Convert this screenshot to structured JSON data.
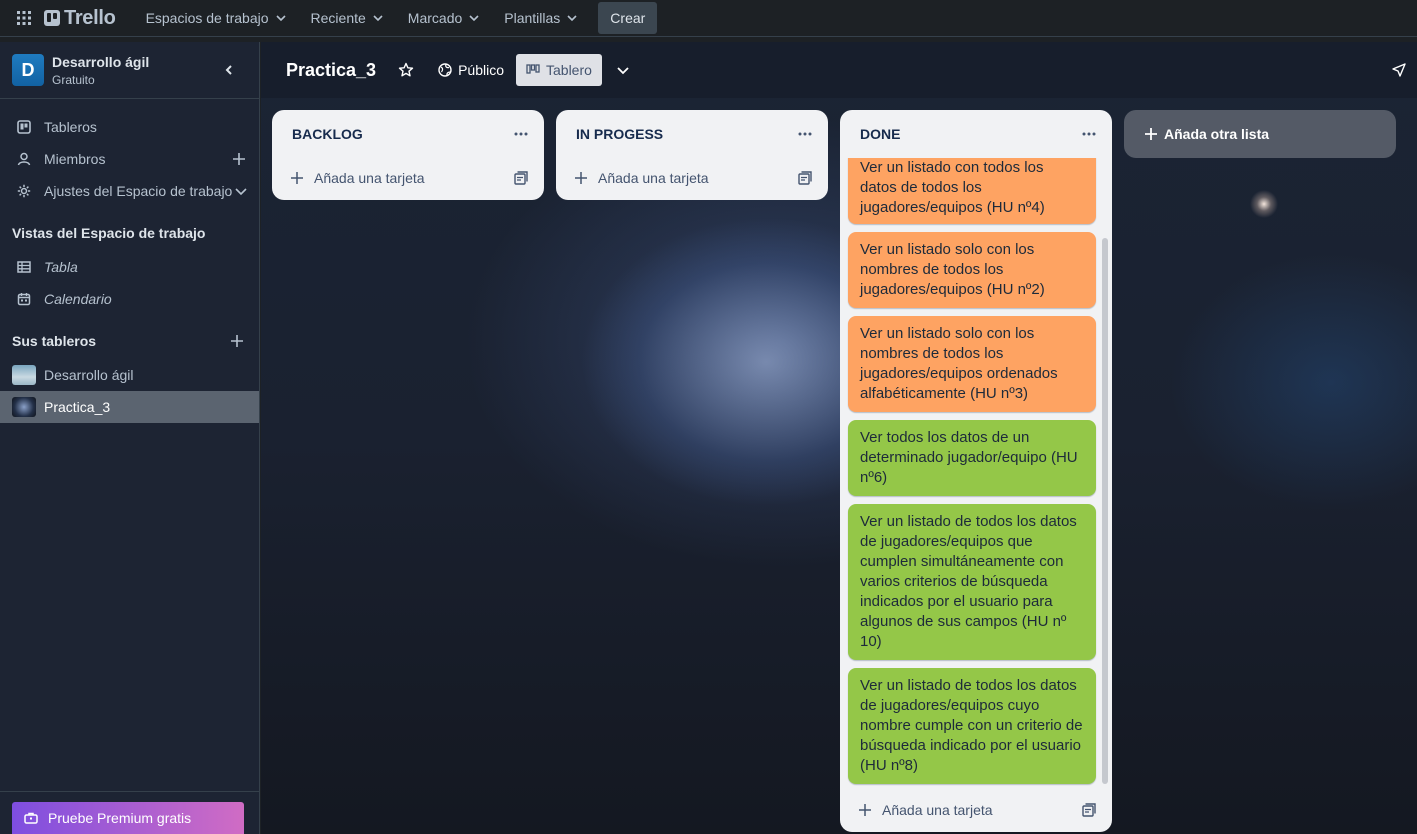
{
  "topbar": {
    "logo_text": "Trello",
    "nav": [
      {
        "label": "Espacios de trabajo"
      },
      {
        "label": "Reciente"
      },
      {
        "label": "Marcado"
      },
      {
        "label": "Plantillas"
      }
    ],
    "create_label": "Crear"
  },
  "sidebar": {
    "workspace": {
      "initial": "D",
      "name": "Desarrollo ágil",
      "plan": "Gratuito"
    },
    "items": [
      {
        "label": "Tableros",
        "icon": "board-icon"
      },
      {
        "label": "Miembros",
        "icon": "person-icon"
      },
      {
        "label": "Ajustes del Espacio de trabajo",
        "icon": "gear-icon"
      }
    ],
    "views_heading": "Vistas del Espacio de trabajo",
    "views": [
      {
        "label": "Tabla",
        "icon": "table-icon"
      },
      {
        "label": "Calendario",
        "icon": "calendar-icon"
      }
    ],
    "boards_heading": "Sus tableros",
    "boards": [
      {
        "label": "Desarrollo ágil"
      },
      {
        "label": "Practica_3"
      }
    ],
    "premium_label": "Pruebe Premium gratis"
  },
  "board": {
    "title": "Practica_3",
    "visibility": "Público",
    "view_label": "Tablero",
    "add_list_label": "Añada otra lista",
    "add_card_label": "Añada una tarjeta",
    "lists": [
      {
        "name": "BACKLOG"
      },
      {
        "name": "IN PROGESS"
      },
      {
        "name": "DONE"
      }
    ],
    "done_cards": [
      {
        "text": "Ver un listado con todos los datos de todos los jugadores/equipos (HU nº4)",
        "color": "#fea362"
      },
      {
        "text": "Ver un listado solo con los nombres de todos los jugadores/equipos (HU nº2)",
        "color": "#fea362"
      },
      {
        "text": "Ver un listado solo con los nombres de todos los jugadores/equipos ordenados alfabéticamente (HU nº3)",
        "color": "#fea362"
      },
      {
        "text": "Ver todos los datos de un determinado jugador/equipo (HU nº6)",
        "color": "#94c748"
      },
      {
        "text": "Ver un listado de todos los datos de jugadores/equipos que cumplen simultáneamente con varios criterios de búsqueda indicados por el usuario para algunos de sus campos (HU nº 10)",
        "color": "#94c748"
      },
      {
        "text": "Ver un listado de todos los datos de jugadores/equipos cuyo nombre cumple con un criterio de búsqueda indicado por el usuario (HU nº8)",
        "color": "#94c748"
      }
    ]
  }
}
